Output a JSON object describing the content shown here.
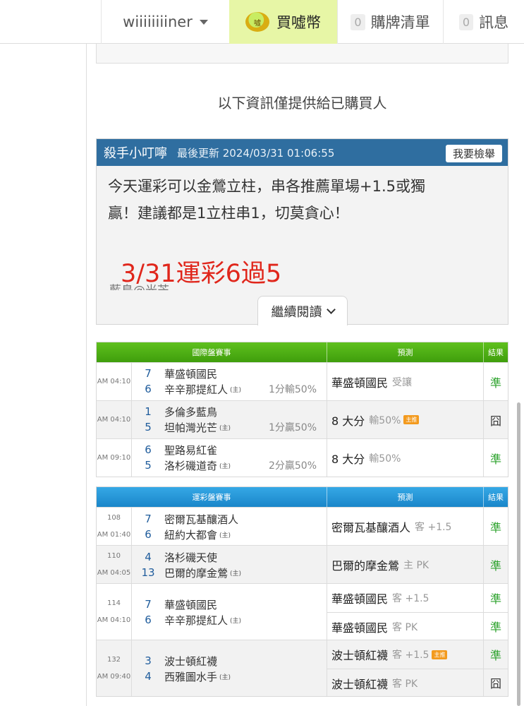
{
  "nav": {
    "username": "wiiiiiiiiner",
    "buy_label": "買噓幣",
    "coin_glyph": "噓",
    "cart_count": "0",
    "cart_label": "購牌清單",
    "msg_count": "0",
    "msg_label": "訊息"
  },
  "notice": "以下資訊僅提供給已購買人",
  "card": {
    "author": "殺手小叮嚀",
    "updated": "最後更新 2024/03/31 01:06:55",
    "report_label": "我要檢舉",
    "text_line1": "今天運彩可以金鶯立柱，串各推薦單場+1.5或獨",
    "text_line2": "贏！建議都是1立柱串1，切莫貪心！",
    "highlight": "3/31運彩6過5",
    "truncated": "藍鳥@光芒",
    "read_more": "繼續閱讀"
  },
  "colors": {
    "header_blue": "#2f6ea0",
    "intl_green": "#4caf14",
    "lottery_blue": "#1a86c9",
    "hit_green": "#2ea32e",
    "highlight_red": "#e0261b"
  },
  "intl_table": {
    "headers": [
      "國際盤賽事",
      "預測",
      "結果"
    ],
    "rows": [
      {
        "time": "AM 04:10",
        "away_score": "7",
        "away": "華盛頓國民",
        "home_score": "6",
        "home": "辛辛那提紅人",
        "home_mark": "(主)",
        "handicap": "1分輸50%",
        "pred": "華盛頓國民",
        "pred_sub": "受讓",
        "tag": "",
        "result": "準",
        "hit": true
      },
      {
        "time": "AM 04:10",
        "away_score": "1",
        "away": "多倫多藍鳥",
        "home_score": "5",
        "home": "坦帕灣光芒",
        "home_mark": "(主)",
        "handicap": "1分贏50%",
        "pred": "8 大分",
        "pred_sub": "輸50%",
        "tag": "主推",
        "result": "囧",
        "hit": false
      },
      {
        "time": "AM 09:10",
        "away_score": "6",
        "away": "聖路易紅雀",
        "home_score": "5",
        "home": "洛杉磯道奇",
        "home_mark": "(主)",
        "handicap": "2分贏50%",
        "pred": "8 大分",
        "pred_sub": "輸50%",
        "tag": "",
        "result": "準",
        "hit": true
      }
    ]
  },
  "lottery_table": {
    "headers": [
      "運彩盤賽事",
      "預測",
      "結果"
    ],
    "rows": [
      {
        "no": "108",
        "time": "AM 01:40",
        "away_score": "7",
        "away": "密爾瓦基釀酒人",
        "home_score": "6",
        "home": "紐約大都會",
        "home_mark": "(主)",
        "preds": [
          {
            "pick": "密爾瓦基釀酒人",
            "sub": "客 +1.5",
            "tag": "",
            "result": "準",
            "hit": true
          }
        ]
      },
      {
        "no": "110",
        "time": "AM 04:05",
        "away_score": "4",
        "away": "洛杉磯天使",
        "home_score": "13",
        "home": "巴爾的摩金鶯",
        "home_mark": "(主)",
        "preds": [
          {
            "pick": "巴爾的摩金鶯",
            "sub": "主 PK",
            "tag": "",
            "result": "準",
            "hit": true
          }
        ]
      },
      {
        "no": "114",
        "time": "AM 04:10",
        "away_score": "7",
        "away": "華盛頓國民",
        "home_score": "6",
        "home": "辛辛那提紅人",
        "home_mark": "(主)",
        "preds": [
          {
            "pick": "華盛頓國民",
            "sub": "客 +1.5",
            "tag": "",
            "result": "準",
            "hit": true
          },
          {
            "pick": "華盛頓國民",
            "sub": "客 PK",
            "tag": "",
            "result": "準",
            "hit": true
          }
        ]
      },
      {
        "no": "132",
        "time": "AM 09:40",
        "away_score": "3",
        "away": "波士頓紅襪",
        "home_score": "4",
        "home": "西雅圖水手",
        "home_mark": "(主)",
        "preds": [
          {
            "pick": "波士頓紅襪",
            "sub": "客 +1.5",
            "tag": "主推",
            "result": "準",
            "hit": true
          },
          {
            "pick": "波士頓紅襪",
            "sub": "客 PK",
            "tag": "",
            "result": "囧",
            "hit": false
          }
        ]
      }
    ]
  }
}
